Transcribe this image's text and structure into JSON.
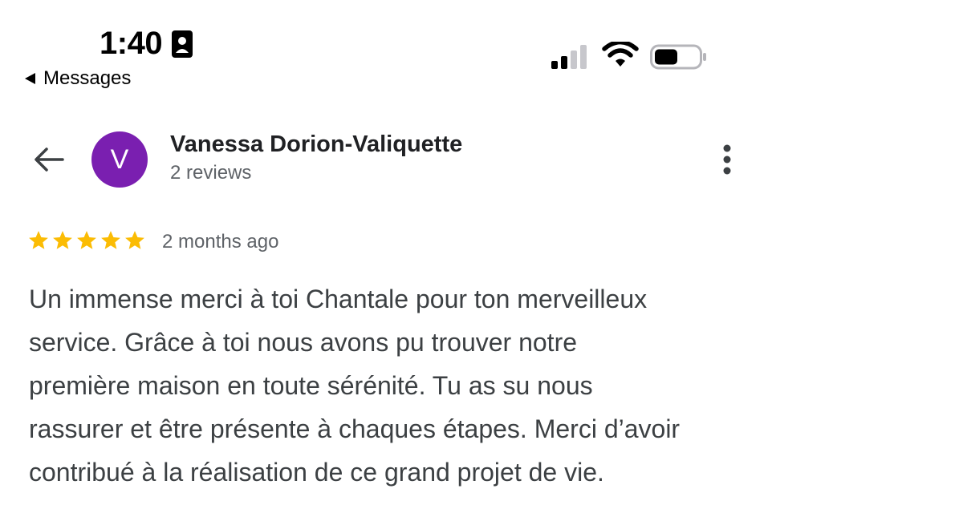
{
  "status_bar": {
    "time": "1:40",
    "back_app_label": "Messages",
    "icons": [
      "contact-card-icon",
      "signal-icon",
      "wifi-icon",
      "battery-icon"
    ]
  },
  "header": {
    "avatar_letter": "V",
    "reviewer_name": "Vanessa Dorion-Valiquette",
    "review_count": "2 reviews",
    "icons": [
      "back-arrow-icon",
      "more-vert-icon"
    ]
  },
  "review": {
    "rating": 5,
    "rating_max": 5,
    "date": "2 months ago",
    "lines": [
      "Un immense merci à toi Chantale pour ton merveilleux",
      "service. Grâce à toi nous avons pu trouver notre",
      "première maison en toute sérénité. Tu as su nous",
      "rassurer et être présente à chaques étapes. Merci d’avoir",
      "contribué à la réalisation de ce grand projet de vie."
    ]
  },
  "colors": {
    "avatar_bg": "#7a1fb0",
    "star": "#fbbc04",
    "text_primary": "#202124",
    "text_secondary": "#5f6368",
    "review_text": "#3c4043"
  }
}
